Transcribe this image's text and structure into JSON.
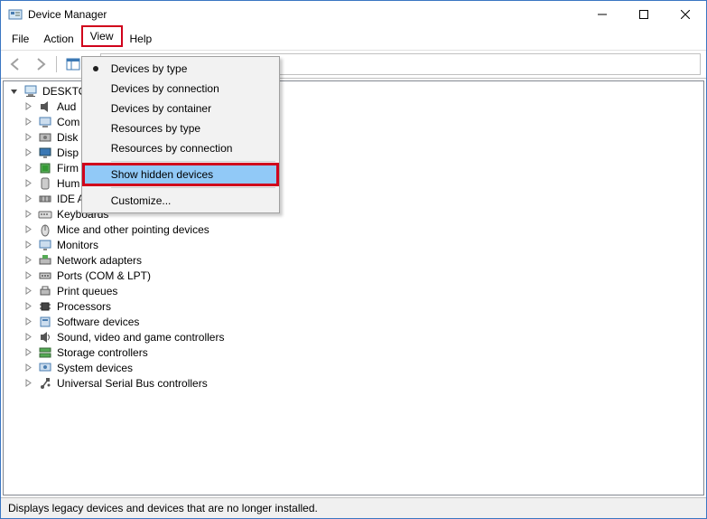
{
  "window": {
    "title": "Device Manager"
  },
  "menubar": {
    "items": [
      "File",
      "Action",
      "View",
      "Help"
    ],
    "highlighted_index": 2
  },
  "dropdown": {
    "items": [
      {
        "label": "Devices by type",
        "radio": true
      },
      {
        "label": "Devices by connection",
        "radio": false
      },
      {
        "label": "Devices by container",
        "radio": false
      },
      {
        "label": "Resources by type",
        "radio": false
      },
      {
        "label": "Resources by connection",
        "radio": false
      }
    ],
    "action_item": {
      "label": "Show hidden devices",
      "selected": true,
      "redbox": true
    },
    "customize": {
      "label": "Customize..."
    }
  },
  "tree": {
    "root": {
      "label": "DESKTO",
      "expanded": true,
      "truncated": true
    },
    "children": [
      {
        "label": "Aud",
        "icon": "audio",
        "truncated": true
      },
      {
        "label": "Com",
        "icon": "computer",
        "truncated": true
      },
      {
        "label": "Disk",
        "icon": "disk",
        "truncated": true
      },
      {
        "label": "Disp",
        "icon": "display",
        "truncated": true
      },
      {
        "label": "Firm",
        "icon": "firmware",
        "truncated": true
      },
      {
        "label": "Hum",
        "icon": "hid",
        "truncated": true
      },
      {
        "label": "IDE A",
        "icon": "ide",
        "truncated": true
      },
      {
        "label": "Keyboards",
        "icon": "keyboard"
      },
      {
        "label": "Mice and other pointing devices",
        "icon": "mouse"
      },
      {
        "label": "Monitors",
        "icon": "monitor"
      },
      {
        "label": "Network adapters",
        "icon": "network"
      },
      {
        "label": "Ports (COM & LPT)",
        "icon": "port"
      },
      {
        "label": "Print queues",
        "icon": "printer"
      },
      {
        "label": "Processors",
        "icon": "processor"
      },
      {
        "label": "Software devices",
        "icon": "software"
      },
      {
        "label": "Sound, video and game controllers",
        "icon": "sound"
      },
      {
        "label": "Storage controllers",
        "icon": "storage"
      },
      {
        "label": "System devices",
        "icon": "system"
      },
      {
        "label": "Universal Serial Bus controllers",
        "icon": "usb"
      }
    ]
  },
  "statusbar": {
    "text": "Displays legacy devices and devices that are no longer installed."
  }
}
